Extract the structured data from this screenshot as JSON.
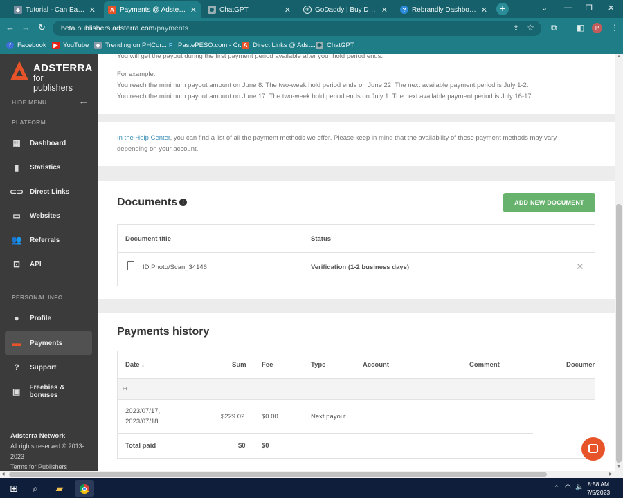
{
  "browser": {
    "tabs": [
      {
        "title": "Tutorial - Can Earn Mon",
        "active": false
      },
      {
        "title": "Payments @ Adsterra",
        "active": true
      },
      {
        "title": "ChatGPT",
        "active": false
      },
      {
        "title": "GoDaddy | Buy Domain",
        "active": false
      },
      {
        "title": "Rebrandly Dashboard",
        "active": false
      }
    ],
    "url_host": "beta.publishers.adsterra.com",
    "url_path": "/payments",
    "profile_initial": "P",
    "bookmarks": [
      "Facebook",
      "YouTube",
      "Trending on PHCor...",
      "PastePESO.com - Cr...",
      "Direct Links @ Adst...",
      "ChatGPT"
    ]
  },
  "sidebar": {
    "brand": "ADSTERRA",
    "brand_sub": "for publishers",
    "hide_menu": "HIDE MENU",
    "platform_label": "PLATFORM",
    "platform_items": [
      "Dashboard",
      "Statistics",
      "Direct Links",
      "Websites",
      "Referrals",
      "API"
    ],
    "personal_label": "PERSONAL INFO",
    "personal_items": [
      "Profile",
      "Payments",
      "Support",
      "Freebies & bonuses"
    ],
    "footer_title": "Adsterra Network",
    "footer_rights": "All rights reserved © 2013-2023",
    "footer_terms": "Terms for Publishers"
  },
  "payout_info": {
    "line_top": "You will get the payout during the first payment period available after your hold period ends.",
    "example_label": "For example:",
    "example_1": "You reach the minimum payout amount on June 8. The two-week hold period ends on June 22. The next available payment period is July 1-2.",
    "example_2": "You reach the minimum payout amount on June 17. The two-week hold period ends on July 1. The next available payment period is July 16-17."
  },
  "help": {
    "link": "In the Help Center",
    "text_1": ", you can find a list of all the payment methods we offer. Please keep in mind that the availability of these payment methods may vary",
    "text_2": "depending on your account."
  },
  "documents": {
    "title": "Documents",
    "add_button": "ADD NEW DOCUMENT",
    "col_title": "Document title",
    "col_status": "Status",
    "rows": [
      {
        "title": "ID Photo/Scan_34146",
        "status": "Verification (1-2 business days)"
      }
    ]
  },
  "payments": {
    "title": "Payments history",
    "columns": [
      "Date ↓",
      "Sum",
      "Fee",
      "Type",
      "Account",
      "Comment",
      "Documen"
    ],
    "rows": [
      {
        "date_1": "2023/07/17,",
        "date_2": "2023/07/18",
        "sum": "$229.02",
        "fee": "$0.00",
        "type": "Next payout",
        "account": "",
        "comment": ""
      }
    ],
    "total_label": "Total paid",
    "total_sum": "$0",
    "total_fee": "$0"
  },
  "taskbar": {
    "time": "8:58 AM",
    "date": "7/5/2023"
  },
  "colors": {
    "browser_frame": "#1f7d87",
    "brand_accent": "#e8542a",
    "button_green": "#67b36d",
    "sidebar_bg": "#3b3b3b"
  }
}
